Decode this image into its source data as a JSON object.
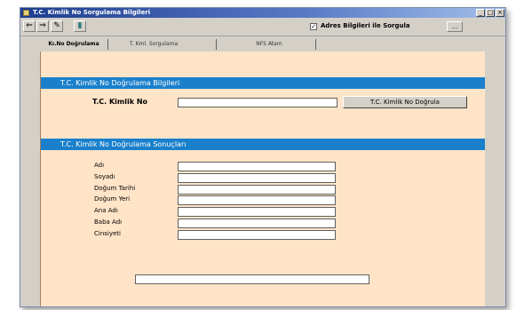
{
  "window": {
    "title": "T.C. Kimlik No Sorgulama Bilgileri",
    "controls": {
      "minimize": "_",
      "maximize": "□",
      "close": "×"
    }
  },
  "toolbar": {
    "buttons": [
      {
        "icon": "back-arrow-icon",
        "glyph": "⇐"
      },
      {
        "icon": "forward-arrow-icon",
        "glyph": "⇒"
      },
      {
        "icon": "tools-icon",
        "glyph": "✎"
      },
      {
        "icon": "book-icon",
        "glyph": "▮"
      }
    ],
    "address_checkbox_label": "Adres Bilgileri ile Sorgula",
    "address_checked": true,
    "address_checkbox_mark": "✓",
    "small_button_label": "..."
  },
  "tabs": [
    {
      "label": "Kı.No Doğrulama",
      "active": true
    },
    {
      "label": "T. Kml. Sorgulama",
      "active": false
    },
    {
      "label": "NFS Atam",
      "active": false
    }
  ],
  "section1": {
    "title": "T.C. Kimlik No Doğrulama Bilgileri",
    "tc_label": "T.C. Kimlik No",
    "tc_value": "",
    "verify_button": "T.C. Kimlik No Doğrula"
  },
  "section2": {
    "title": "T.C. Kimlik No Doğrulama Sonuçları",
    "fields": [
      {
        "label": "Adı",
        "value": ""
      },
      {
        "label": "Soyadı",
        "value": ""
      },
      {
        "label": "Doğum Tarihi",
        "value": ""
      },
      {
        "label": "Doğum Yeri",
        "value": ""
      },
      {
        "label": "Ana Adı",
        "value": ""
      },
      {
        "label": "Baba Adı",
        "value": ""
      },
      {
        "label": "Cinsiyeti",
        "value": ""
      }
    ],
    "result_message": ""
  },
  "colors": {
    "title_bar": "#1d3d8e",
    "section_header": "#1a80cc",
    "panel_background": "#ffe4c8"
  }
}
